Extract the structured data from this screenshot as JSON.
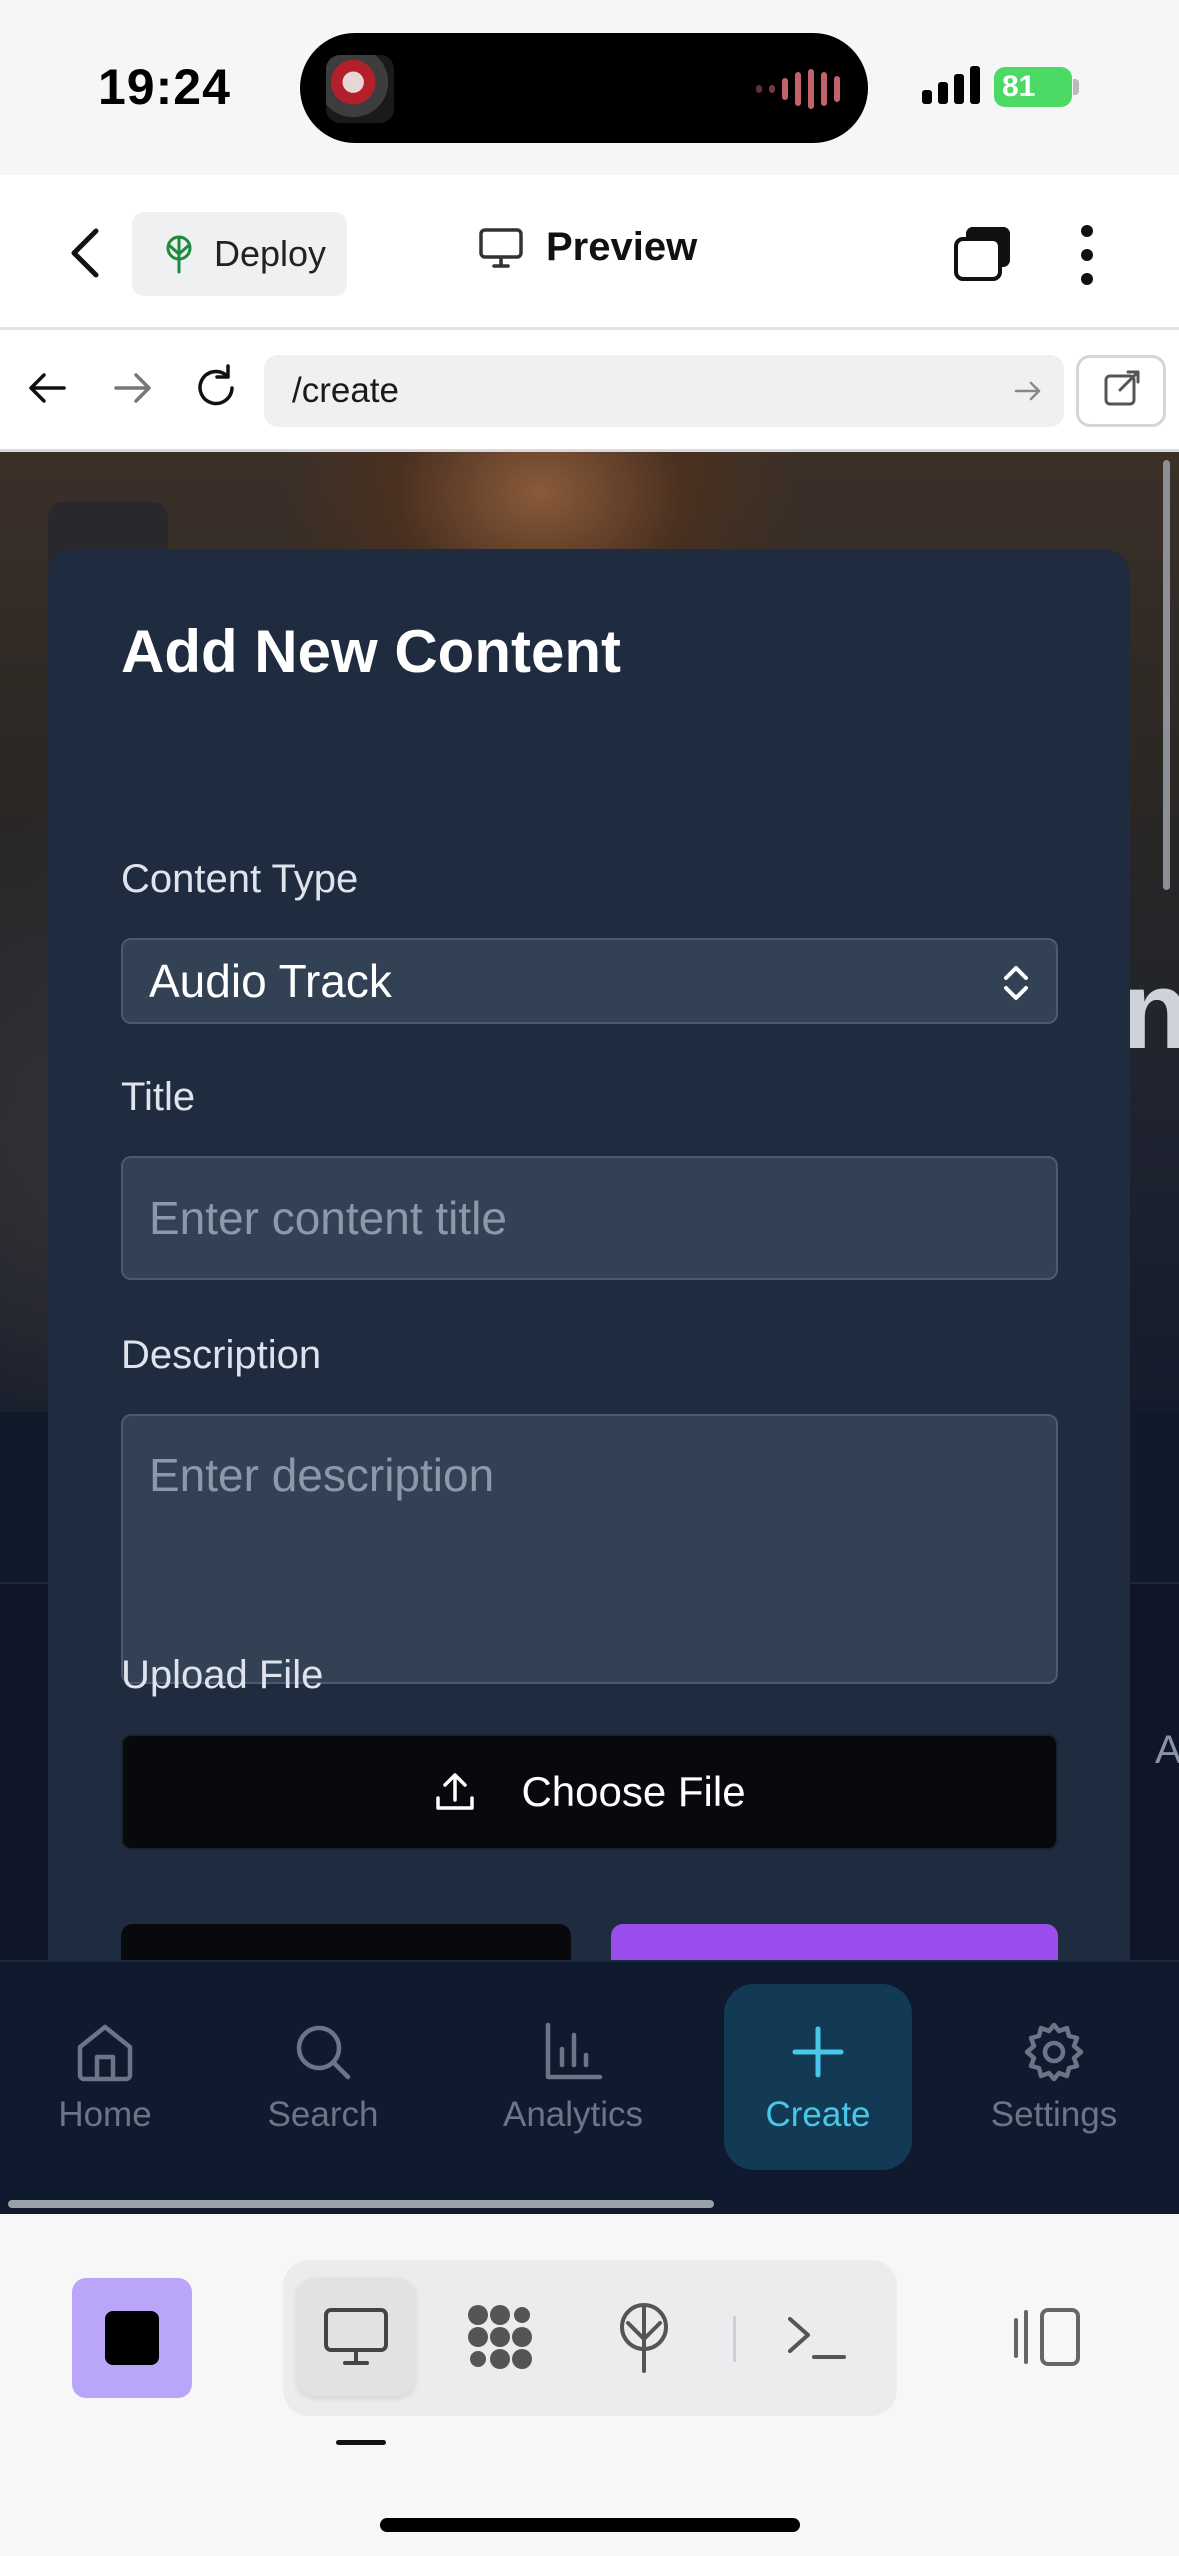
{
  "status_bar": {
    "time": "19:24",
    "battery": "81"
  },
  "app_header": {
    "deploy_label": "Deploy",
    "preview_label": "Preview"
  },
  "browser": {
    "url": "/create"
  },
  "modal": {
    "title": "Add New Content",
    "content_type_label": "Content Type",
    "content_type_value": "Audio Track",
    "title_label": "Title",
    "title_placeholder": "Enter content title",
    "description_label": "Description",
    "description_placeholder": "Enter description",
    "upload_label": "Upload File",
    "choose_file_label": "Choose File"
  },
  "background_peek": {
    "right_letter": "n",
    "right_letter_2": "A"
  },
  "tabbar": {
    "items": [
      {
        "label": "Home",
        "icon": "home-icon",
        "active": false
      },
      {
        "label": "Search",
        "icon": "search-icon",
        "active": false
      },
      {
        "label": "Analytics",
        "icon": "analytics-icon",
        "active": false
      },
      {
        "label": "Create",
        "icon": "plus-icon",
        "active": true
      },
      {
        "label": "Settings",
        "icon": "gear-icon",
        "active": false
      }
    ]
  },
  "toolbar": {
    "icons": [
      "stop-icon",
      "desktop-icon",
      "apps-icon",
      "deploy-icon",
      "terminal-icon",
      "panel-icon"
    ]
  },
  "colors": {
    "accent_purple": "#9b4dee",
    "create_tab": "#48c8e8",
    "modal_bg": "#1f2b3e"
  }
}
